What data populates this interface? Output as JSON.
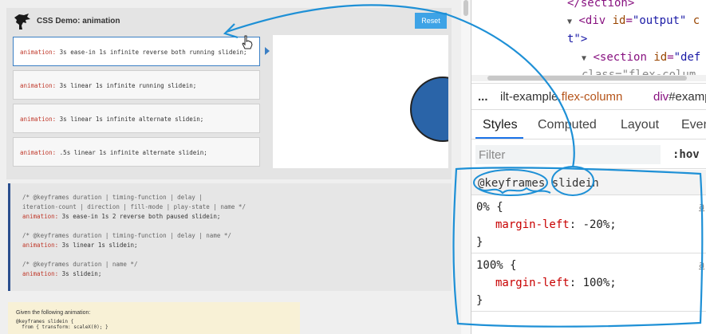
{
  "demo": {
    "title": "CSS Demo: animation",
    "reset_label": "Reset",
    "choices": [
      {
        "prop": "animation:",
        "value": " 3s ease-in 1s infinite reverse both running slidein;"
      },
      {
        "prop": "animation:",
        "value": " 3s linear 1s infinite running slidein;"
      },
      {
        "prop": "animation:",
        "value": " 3s linear 1s infinite alternate slidein;"
      },
      {
        "prop": "animation:",
        "value": " .5s linear 1s infinite alternate slidein;"
      }
    ],
    "selected_index": 0
  },
  "code": {
    "block1_comment1": "/* @keyframes duration | timing-function | delay |",
    "block1_comment2": "iteration-count | direction | fill-mode | play-state | name */",
    "block1_prop": "animation:",
    "block1_value": " 3s ease-in 1s 2 reverse both paused slidein;",
    "block2_comment": "/* @keyframes duration | timing-function | delay | name */",
    "block2_prop": "animation:",
    "block2_value": " 3s linear 1s slidein;",
    "block3_comment": "/* @keyframes duration | name */",
    "block3_prop": "animation:",
    "block3_value": " 3s slidein;"
  },
  "note": {
    "text": "Given the following animation:",
    "code_line1": "@keyframes slidein {",
    "code_line2": "  from { transform: scaleX(0); }"
  },
  "devtools": {
    "tree": {
      "line1_tag": "</section>",
      "line2_open": "<div ",
      "line2_attr": "id",
      "line2_eq": "=",
      "line2_val": "\"output\"",
      "line2_tail": " c",
      "line3": "t\">",
      "line4_open": "<section ",
      "line4_attr": "id",
      "line4_eq": "=",
      "line4_val": "\"def",
      "line5": "class=\"flex-colum"
    },
    "breadcrumb": {
      "ellipsis": "...",
      "crumb1_prefix": "ilt-example",
      "crumb1_class": ".flex-column",
      "crumb2_tag": "div",
      "crumb2_id": "#examp"
    },
    "tabs": [
      "Styles",
      "Computed",
      "Layout",
      "Even"
    ],
    "active_tab": "Styles",
    "filter_placeholder": "Filter",
    "hov_label": ":hov",
    "keyframes_title": "@keyframes slidein",
    "rules": [
      {
        "selector": "0% {",
        "prop": "margin-left",
        "value": "-20%;",
        "close": "}",
        "source": "a"
      },
      {
        "selector": "100% {",
        "prop": "margin-left",
        "value": "100%;",
        "close": "}",
        "source": "a"
      }
    ]
  },
  "colors": {
    "annotation": "#1e90d6",
    "accent": "#3ea3e6",
    "circle": "#2a64a8"
  },
  "icons": [
    "dinosaur-logo-icon",
    "hand-cursor-icon"
  ]
}
